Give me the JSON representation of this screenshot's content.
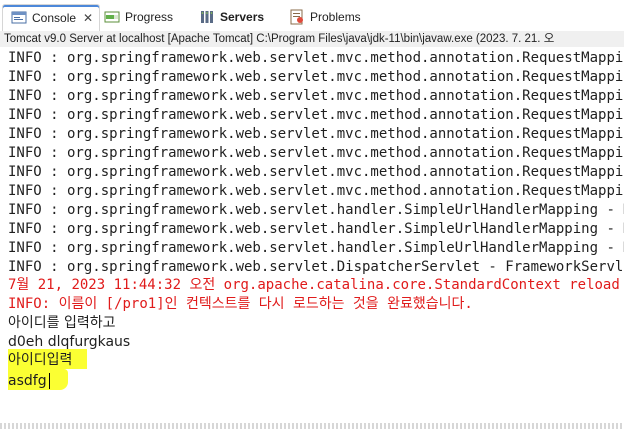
{
  "tabs": [
    {
      "label": "Console",
      "active": true,
      "icon": "console-icon",
      "close": "✕"
    },
    {
      "label": "Progress",
      "active": false,
      "icon": "progress-icon"
    },
    {
      "label": "Servers",
      "active": false,
      "icon": "servers-icon"
    },
    {
      "label": "Problems",
      "active": false,
      "icon": "problems-icon"
    }
  ],
  "status_line": "Tomcat v9.0 Server at localhost [Apache Tomcat] C:\\Program Files\\java\\jdk-11\\bin\\javaw.exe  (2023. 7. 21. 오",
  "log_lines": [
    "INFO : org.springframework.web.servlet.mvc.method.annotation.RequestMappingHa",
    "INFO : org.springframework.web.servlet.mvc.method.annotation.RequestMappingHa",
    "INFO : org.springframework.web.servlet.mvc.method.annotation.RequestMappingHa",
    "INFO : org.springframework.web.servlet.mvc.method.annotation.RequestMappingHa",
    "INFO : org.springframework.web.servlet.mvc.method.annotation.RequestMappingHa",
    "INFO : org.springframework.web.servlet.mvc.method.annotation.RequestMappingHa",
    "INFO : org.springframework.web.servlet.mvc.method.annotation.RequestMappingHa",
    "INFO : org.springframework.web.servlet.mvc.method.annotation.RequestMappingHa",
    "INFO : org.springframework.web.servlet.handler.SimpleUrlHandlerMapping - Mapp",
    "INFO : org.springframework.web.servlet.handler.SimpleUrlHandlerMapping - Mapp",
    "INFO : org.springframework.web.servlet.handler.SimpleUrlHandlerMapping - Mapp",
    "INFO : org.springframework.web.servlet.DispatcherServlet - FrameworkServlet '"
  ],
  "red_lines": [
    "7월 21, 2023 11:44:32 오전 org.apache.catalina.core.StandardContext reload",
    "INFO: 이름이 [/pro1]인 컨텍스트를 다시 로드하는 것을 완료했습니다."
  ],
  "user_lines": [
    "아이디를 입력하고",
    "d0eh dlqfurgkaus",
    "아이디입력",
    "asdfg"
  ],
  "colors": {
    "error_red": "#e01b1b",
    "highlight_yellow": "#fbff33",
    "active_tab_accent": "#4d88d9"
  }
}
